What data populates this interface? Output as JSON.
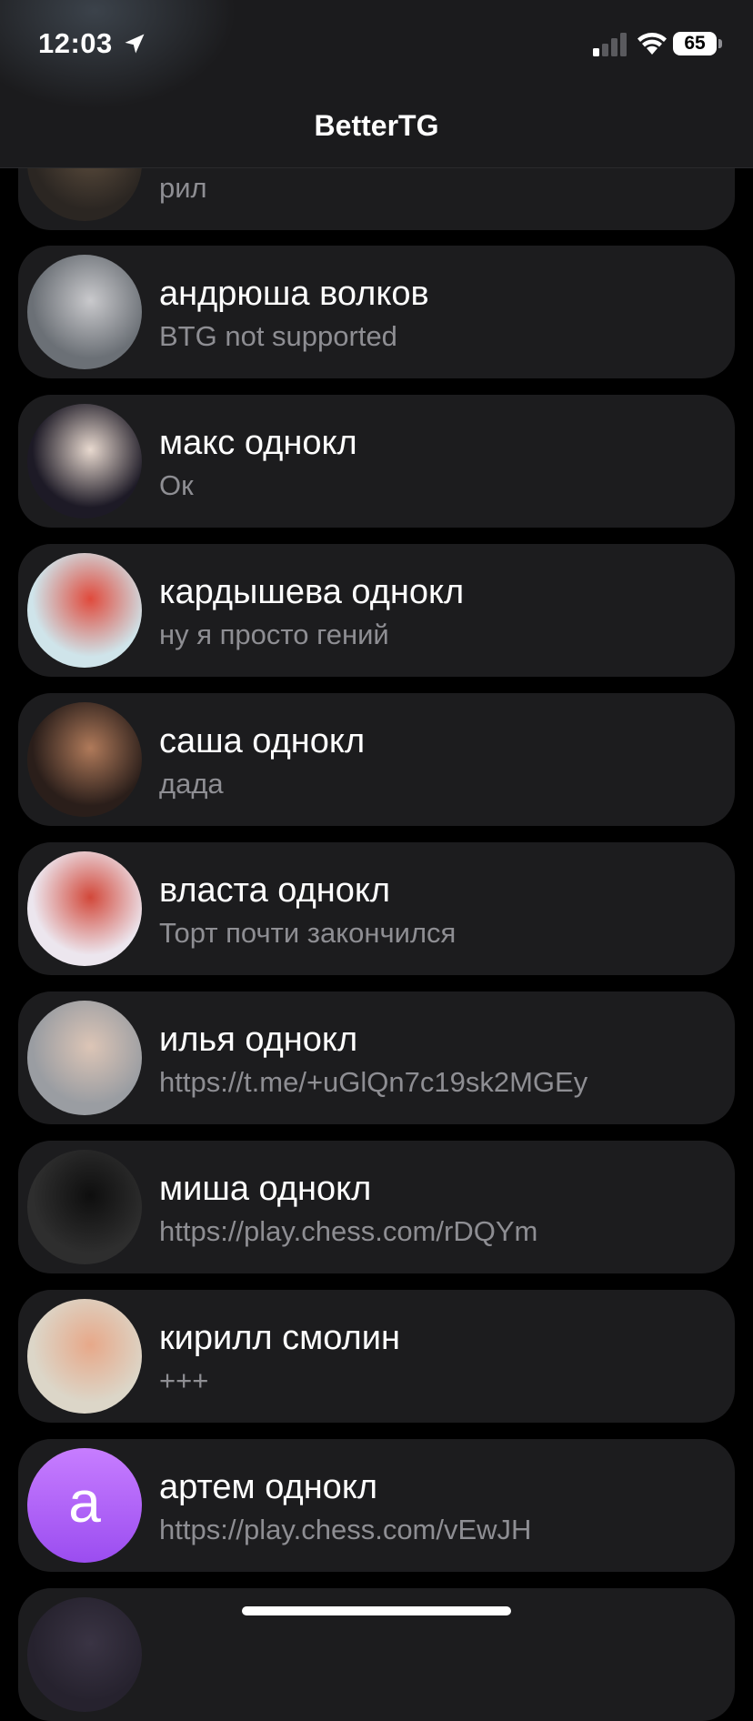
{
  "status_bar": {
    "time": "12:03",
    "battery": "65"
  },
  "header": {
    "title": "BetterTG"
  },
  "chats": [
    {
      "name": "",
      "message": "рил",
      "avatar": {
        "kind": "photo",
        "bg": "#2b2622",
        "fg": "#5a4b3c"
      }
    },
    {
      "name": "андрюша волков",
      "message": "BTG not supported",
      "avatar": {
        "kind": "photo",
        "bg": "#6b7076",
        "fg": "#c9c9cc"
      }
    },
    {
      "name": "макс однокл",
      "message": "Ок",
      "avatar": {
        "kind": "photo",
        "bg": "#1d1a26",
        "fg": "#e8d9cf"
      }
    },
    {
      "name": "кардышева однокл",
      "message": "ну я просто гений",
      "avatar": {
        "kind": "photo",
        "bg": "#cfe4ea",
        "fg": "#e04a3c"
      }
    },
    {
      "name": "саша однокл",
      "message": "дада",
      "avatar": {
        "kind": "photo",
        "bg": "#2a1e1a",
        "fg": "#b07a5a"
      }
    },
    {
      "name": "власта однокл",
      "message": "Торт почти закончился",
      "avatar": {
        "kind": "photo",
        "bg": "#ece6ee",
        "fg": "#d2483a"
      }
    },
    {
      "name": "илья однокл",
      "message": "https://t.me/+uGlQn7c19sk2MGEy",
      "avatar": {
        "kind": "photo",
        "bg": "#9a9da2",
        "fg": "#dcc5b6"
      }
    },
    {
      "name": "миша однокл",
      "message": "https://play.chess.com/rDQYm",
      "avatar": {
        "kind": "photo",
        "bg": "#2e2e2e",
        "fg": "#0e0e0e"
      }
    },
    {
      "name": "кирилл смолин",
      "message": "+++",
      "avatar": {
        "kind": "photo",
        "bg": "#dcd6c8",
        "fg": "#e7a889"
      }
    },
    {
      "name": "артем однокл",
      "message": "https://play.chess.com/vEwJH",
      "avatar": {
        "kind": "initial",
        "letter": "а",
        "bg_top": "#c77dff",
        "bg_bottom": "#9b4df0"
      }
    },
    {
      "name": "",
      "message": "",
      "avatar": {
        "kind": "photo",
        "bg": "#26222e",
        "fg": "#3a3444"
      }
    }
  ]
}
